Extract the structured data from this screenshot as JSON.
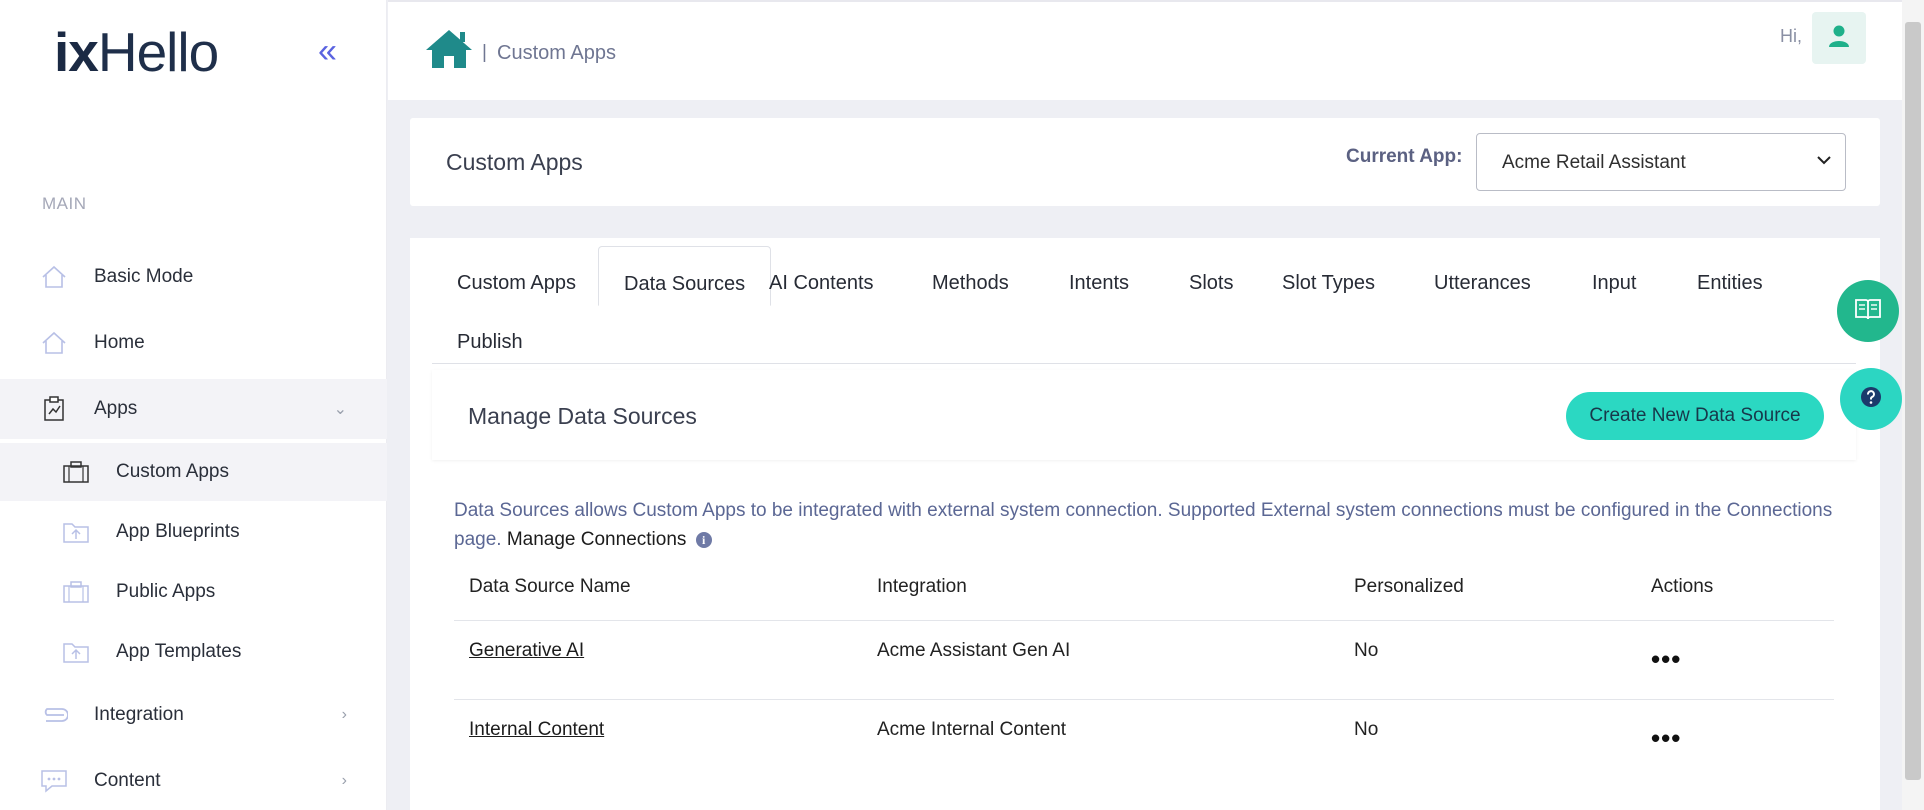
{
  "sidebar": {
    "logo_ix": "ix",
    "logo_rest": "Hello",
    "collapse_icon": "«",
    "section_label": "MAIN",
    "items": [
      {
        "label": "Basic Mode",
        "icon": "house-outline-icon"
      },
      {
        "label": "Home",
        "icon": "house-outline-icon"
      },
      {
        "label": "Apps",
        "icon": "clipboard-chart-icon",
        "chevron": "⌄"
      },
      {
        "label": "Integration",
        "icon": "paperclip-icon",
        "chevron": "›"
      },
      {
        "label": "Content",
        "icon": "chat-bubble-icon",
        "chevron": "›"
      }
    ],
    "sub_items": [
      {
        "label": "Custom Apps",
        "icon": "briefcase-icon"
      },
      {
        "label": "App Blueprints",
        "icon": "folder-upload-icon"
      },
      {
        "label": "Public Apps",
        "icon": "briefcase-icon"
      },
      {
        "label": "App Templates",
        "icon": "folder-upload-icon"
      }
    ]
  },
  "header": {
    "breadcrumb_sep": "|",
    "breadcrumb": "Custom Apps",
    "greeting": "Hi,"
  },
  "title_card": {
    "title": "Custom Apps",
    "current_app_label": "Current App:",
    "current_app_value": "Acme Retail Assistant"
  },
  "tabs": [
    "Custom Apps",
    "Data Sources",
    "AI Contents",
    "Methods",
    "Intents",
    "Slots",
    "Slot Types",
    "Utterances",
    "Input",
    "Entities",
    "Publish"
  ],
  "active_tab": "Data Sources",
  "manage": {
    "heading": "Manage Data Sources",
    "create_button": "Create New Data Source"
  },
  "info": {
    "text": "Data Sources allows Custom Apps to be integrated with external system connection. Supported External system connections must be configured in the Connections page.",
    "link": "Manage Connections",
    "info_glyph": "i"
  },
  "table": {
    "headers": [
      "Data Source Name",
      "Integration",
      "Personalized",
      "Actions"
    ],
    "rows": [
      {
        "name": "Generative AI",
        "integration": "Acme Assistant Gen AI",
        "personalized": "No",
        "actions": "•••"
      },
      {
        "name": "Internal Content",
        "integration": "Acme Internal Content",
        "personalized": "No",
        "actions": "•••"
      }
    ]
  },
  "colors": {
    "accent_teal": "#2bd8c2",
    "brand_green": "#22b78d",
    "text_muted": "#5b6794"
  }
}
